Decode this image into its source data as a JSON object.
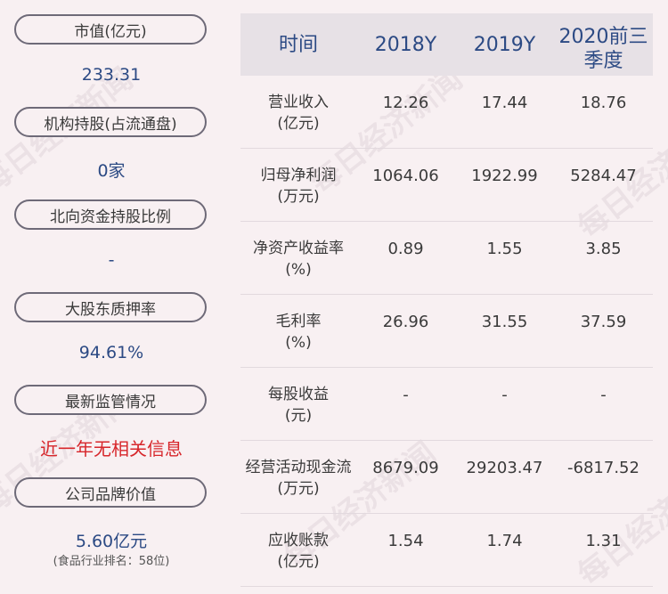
{
  "left": {
    "items": [
      {
        "label": "市值(亿元)",
        "value": "233.31"
      },
      {
        "label": "机构持股(占流通盘)",
        "value": "0家"
      },
      {
        "label": "北向资金持股比例",
        "value": "-"
      },
      {
        "label": "大股东质押率",
        "value": "94.61%"
      },
      {
        "label": "最新监管情况",
        "value": "近一年无相关信息"
      },
      {
        "label": "公司品牌价值",
        "value": "5.60亿元",
        "sub": "(食品行业排名：58位)"
      }
    ]
  },
  "table": {
    "headers": [
      "时间",
      "2018Y",
      "2019Y",
      "2020前三\n季度"
    ],
    "rows": [
      {
        "label": "营业收入\n(亿元)",
        "values": [
          "12.26",
          "17.44",
          "18.76"
        ]
      },
      {
        "label": "归母净利润\n(万元)",
        "values": [
          "1064.06",
          "1922.99",
          "5284.47"
        ]
      },
      {
        "label": "净资产收益率\n(%)",
        "values": [
          "0.89",
          "1.55",
          "3.85"
        ]
      },
      {
        "label": "毛利率\n(%)",
        "values": [
          "26.96",
          "31.55",
          "37.59"
        ]
      },
      {
        "label": "每股收益\n(元)",
        "values": [
          "-",
          "-",
          "-"
        ]
      },
      {
        "label": "经营活动现金流\n(万元)",
        "values": [
          "8679.09",
          "29203.47",
          "-6817.52"
        ]
      },
      {
        "label": "应收账款\n(亿元)",
        "values": [
          "1.54",
          "1.74",
          "1.31"
        ]
      }
    ]
  },
  "watermark": "每日经济新闻",
  "colors": {
    "background": "#f8f0f2",
    "value_blue": "#2c4a84",
    "alert_red": "#d7262b",
    "header_bg": "#e7e1e6"
  }
}
